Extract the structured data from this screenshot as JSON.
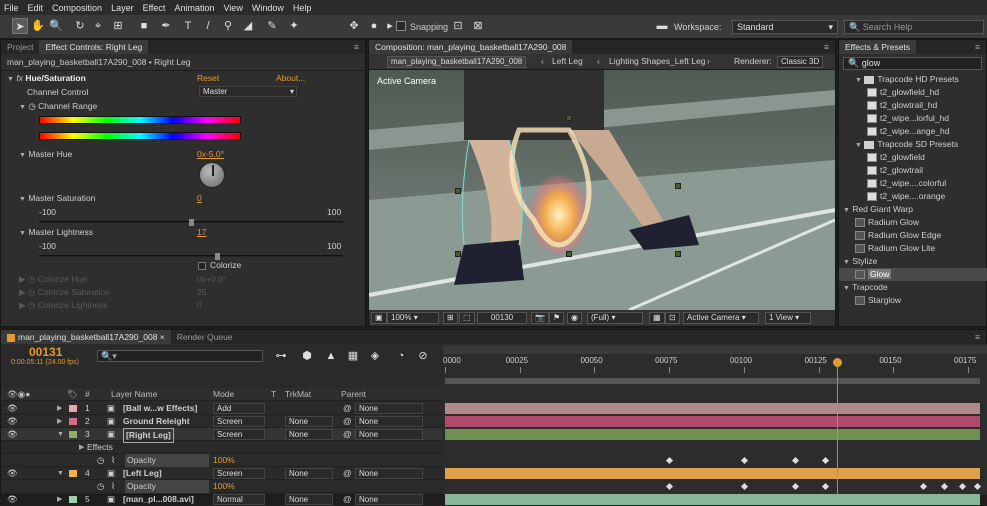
{
  "menubar": [
    "File",
    "Edit",
    "Composition",
    "Layer",
    "Effect",
    "Animation",
    "View",
    "Window",
    "Help"
  ],
  "toolbar": {
    "snapping_label": "Snapping",
    "workspace_label": "Workspace:",
    "workspace_value": "Standard",
    "search_placeholder": "Search Help"
  },
  "left_panel": {
    "tab_project": "Project",
    "tab_effect_controls": "Effect Controls: Right Leg",
    "breadcrumb": "man_playing_basketball17A290_008 • Right Leg",
    "effect_name": "Hue/Saturation",
    "reset": "Reset",
    "about": "About...",
    "channel_control_label": "Channel Control",
    "channel_control_value": "Master",
    "channel_range_label": "Channel Range",
    "master_hue_label": "Master Hue",
    "master_hue_value": "0x-5.0°",
    "master_saturation_label": "Master Saturation",
    "master_saturation_value": "0",
    "sat_min": "-100",
    "sat_max": "100",
    "master_lightness_label": "Master Lightness",
    "master_lightness_value": "17",
    "light_min": "-100",
    "light_max": "100",
    "colorize_label": "Colorize",
    "colorize_hue_label": "Colorize Hue",
    "colorize_hue_value": "0x+0.0°",
    "colorize_saturation_label": "Colorize Saturation",
    "colorize_saturation_value": "25",
    "colorize_lightness_label": "Colorize Lightness",
    "colorize_lightness_value": "0"
  },
  "comp_panel": {
    "tab": "Composition: man_playing_basketball17A290_008",
    "nav_items": [
      "man_playing_basketball17A290_008",
      "Left Leg",
      "Lighting Shapes_Left Leg"
    ],
    "renderer_label": "Renderer:",
    "renderer_value": "Classic 3D",
    "active_camera_overlay": "Active Camera",
    "zoom": "100%",
    "timecode": "00130",
    "resolution": "(Full)",
    "camera": "Active Camera",
    "views": "1 View"
  },
  "effects_panel": {
    "tab": "Effects & Presets",
    "search_value": "glow",
    "items": [
      {
        "label": "Trapcode HD Presets",
        "kind": "folder",
        "indent": 1
      },
      {
        "label": "t2_glowfield_hd",
        "kind": "preset",
        "indent": 2
      },
      {
        "label": "t2_glowtrail_hd",
        "kind": "preset",
        "indent": 2
      },
      {
        "label": "t2_wipe...lorful_hd",
        "kind": "preset",
        "indent": 2
      },
      {
        "label": "t2_wipe...ange_hd",
        "kind": "preset",
        "indent": 2
      },
      {
        "label": "Trapcode SD Presets",
        "kind": "folder",
        "indent": 1
      },
      {
        "label": "t2_glowfield",
        "kind": "preset",
        "indent": 2
      },
      {
        "label": "t2_glowtrail",
        "kind": "preset",
        "indent": 2
      },
      {
        "label": "t2_wipe....colorful",
        "kind": "preset",
        "indent": 2
      },
      {
        "label": "t2_wipe....orange",
        "kind": "preset",
        "indent": 2
      },
      {
        "label": "Red Giant Warp",
        "kind": "category",
        "indent": 0
      },
      {
        "label": "Radium Glow",
        "kind": "effect",
        "indent": 1
      },
      {
        "label": "Radium Glow Edge",
        "kind": "effect",
        "indent": 1
      },
      {
        "label": "Radium Glow Lite",
        "kind": "effect",
        "indent": 1
      },
      {
        "label": "Stylize",
        "kind": "category",
        "indent": 0
      },
      {
        "label": "Glow",
        "kind": "effect",
        "indent": 1,
        "selected": true
      },
      {
        "label": "Trapcode",
        "kind": "category",
        "indent": 0
      },
      {
        "label": "Starglow",
        "kind": "effect",
        "indent": 1
      }
    ]
  },
  "timeline": {
    "tab": "man_playing_basketball17A290_008",
    "tab_render": "Render Queue",
    "current_time": "00131",
    "current_time_sub": "0:00:05:11 (24.00 fps)",
    "search_placeholder": "",
    "headers": {
      "hash": "#",
      "layer_name": "Layer Name",
      "mode": "Mode",
      "t": "T",
      "trkmat": "TrkMat",
      "parent": "Parent"
    },
    "ruler": [
      "0000",
      "00025",
      "00050",
      "00075",
      "00100",
      "00125",
      "00150",
      "00175"
    ],
    "layers": [
      {
        "num": "1",
        "name": "[Ball w...w Effects]",
        "mode": "Add",
        "trkmat": "",
        "parent": "None",
        "color": "#e8a7a7",
        "bar": "#b08a8a",
        "bar_start": 0,
        "bar_end": 1
      },
      {
        "num": "2",
        "name": "Ground Releight",
        "mode": "Screen",
        "trkmat": "None",
        "parent": "None",
        "color": "#d36a86",
        "bar": "#b04a6b",
        "bar_start": 0,
        "bar_end": 1
      },
      {
        "num": "3",
        "name": "[Right Leg]",
        "mode": "Screen",
        "trkmat": "None",
        "parent": "None",
        "color": "#8ab26a",
        "bar": "#6f8f55",
        "bar_start": 0,
        "bar_end": 1,
        "selected": true
      },
      {
        "num": "4",
        "name": "[Left Leg]",
        "mode": "Screen",
        "trkmat": "None",
        "parent": "None",
        "color": "#f0b050",
        "bar": "#e0a04a",
        "bar_start": 0,
        "bar_end": 1
      },
      {
        "num": "5",
        "name": "[man_pl...008.avi]",
        "mode": "Normal",
        "trkmat": "None",
        "parent": "None",
        "color": "#9fd0a8",
        "bar": "#86b895",
        "bar_start": 0,
        "bar_end": 1
      }
    ],
    "effects_label": "Effects",
    "opacity_label": "Opacity",
    "opacity_value": "100%",
    "opacity_value_2": "100%",
    "keyframes_row3": [
      75,
      100,
      117,
      127
    ],
    "keyframes_row4": [
      75,
      100,
      117,
      127,
      160,
      167,
      173,
      178
    ]
  },
  "colors": {
    "accent": "#e49b2d",
    "playhead": "#e86a8a"
  }
}
